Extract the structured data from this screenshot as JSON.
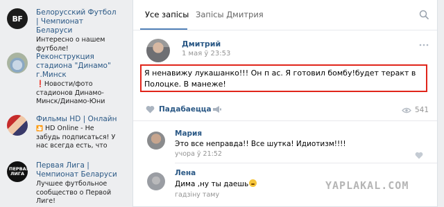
{
  "ads": [
    {
      "title": "Белорусский Футбол | Чемпионат Беларуси",
      "desc": "Интересно о нашем футболе!",
      "logo": "BF"
    },
    {
      "title": "Реконструкция стадиона \"Динамо\" г.Минск",
      "desc": "Новости/фото стадионов Динамо-Минск/Динамо-Юни"
    },
    {
      "title": "Фильмы HD | Онлайн",
      "desc": "HD Online - Не забудь подписаться! У нас всегда есть, что"
    },
    {
      "title": "Первая Лига | Чемпионат Беларуси",
      "desc": "Лучшее футбольное сообщество о Первой Лиге!",
      "logo": "ПЕРВАЯ ЛИГА"
    }
  ],
  "tabs": {
    "all": "Усе запісы",
    "author": "Запісы Дмитрия"
  },
  "post": {
    "author": "Дмитрий",
    "date": "1 мая ў 23:53",
    "text": "Я ненавижу лукашанко!!! Он п         ас. Я готовил бомбу!будет теракт в Полоцке. В манеже!",
    "like_label": "Падабаецца",
    "views": "541"
  },
  "comments": [
    {
      "author": "Мария",
      "text": "Это все неправда!! Все шутка! Идиотизм!!!!",
      "date": "учора ў 21:52"
    },
    {
      "author": "Лена",
      "text": "Дима ,ну ты даешь",
      "date": "гадзіну таму"
    }
  ],
  "watermark": "YAPLAKAL.COM",
  "colors": {
    "link": "#2a5885",
    "highlight_border": "#e0241a",
    "tab_active": "#5181b8"
  }
}
